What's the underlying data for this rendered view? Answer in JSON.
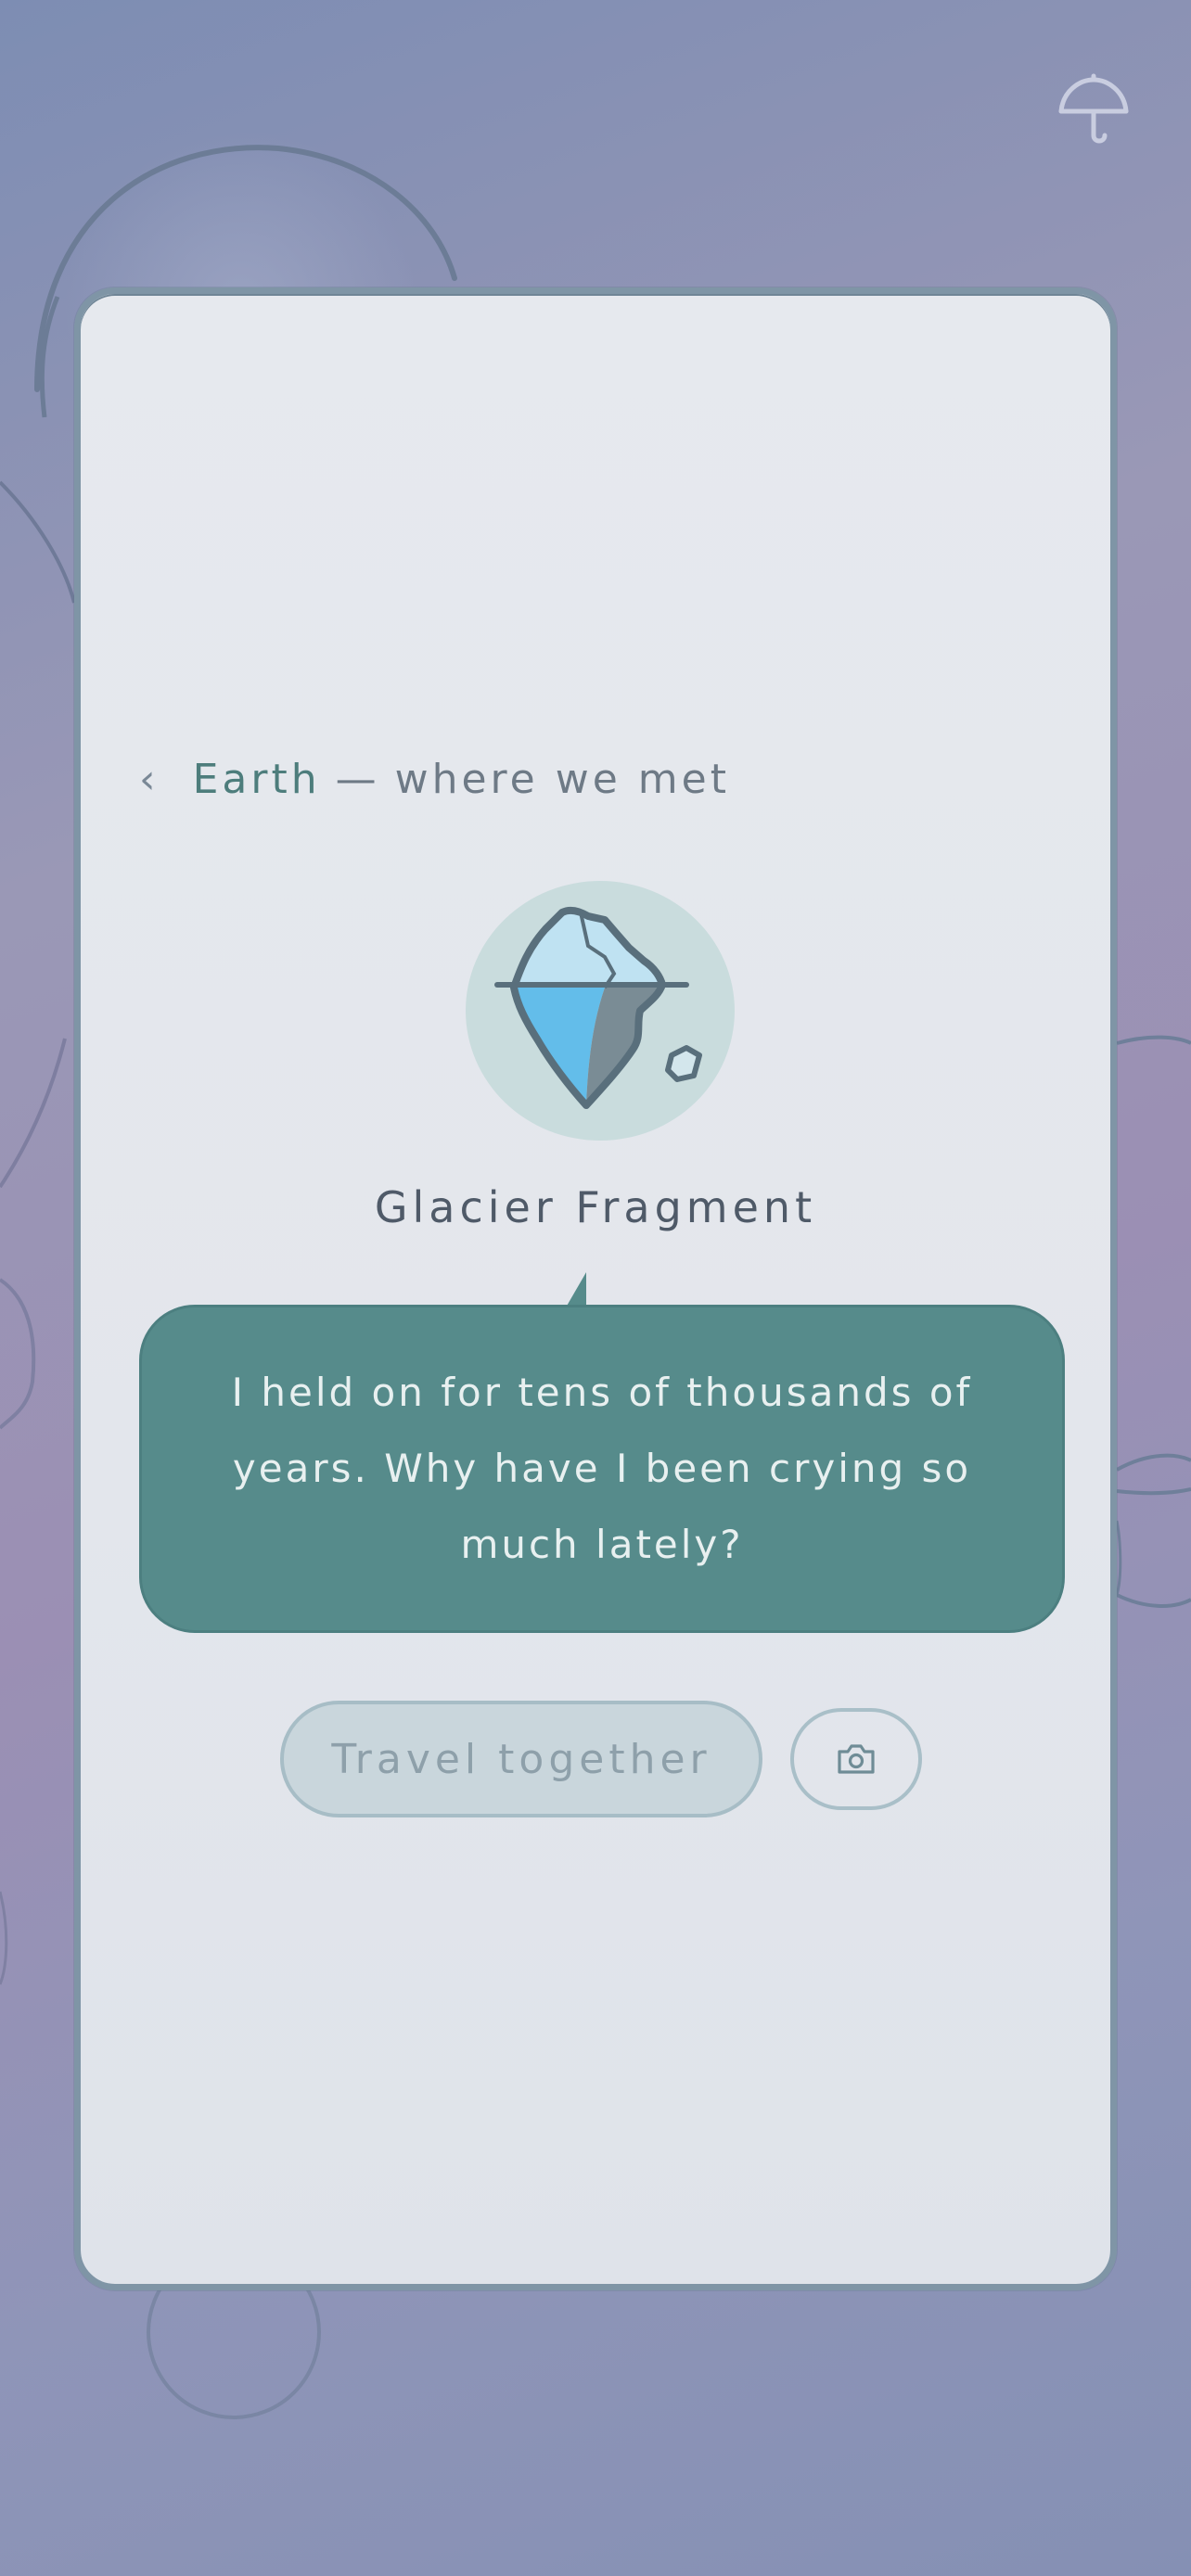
{
  "breadcrumb": {
    "back_glyph": "‹",
    "place": "Earth",
    "separator": "—",
    "subtitle": "where we met"
  },
  "item": {
    "name": "Glacier Fragment",
    "icon": "iceberg-icon"
  },
  "speech": {
    "text": "I held on for tens of thousands of years. Why have I been crying so much lately?"
  },
  "actions": {
    "travel_label": "Travel together",
    "camera_icon": "camera-icon"
  },
  "top_right_icon": "umbrella-icon",
  "colors": {
    "accent_teal": "#568b8b",
    "place_text": "#4d7d7c",
    "card_border": "#7f95a6",
    "background_start": "#7d8db3",
    "background_end": "#8590b4"
  }
}
